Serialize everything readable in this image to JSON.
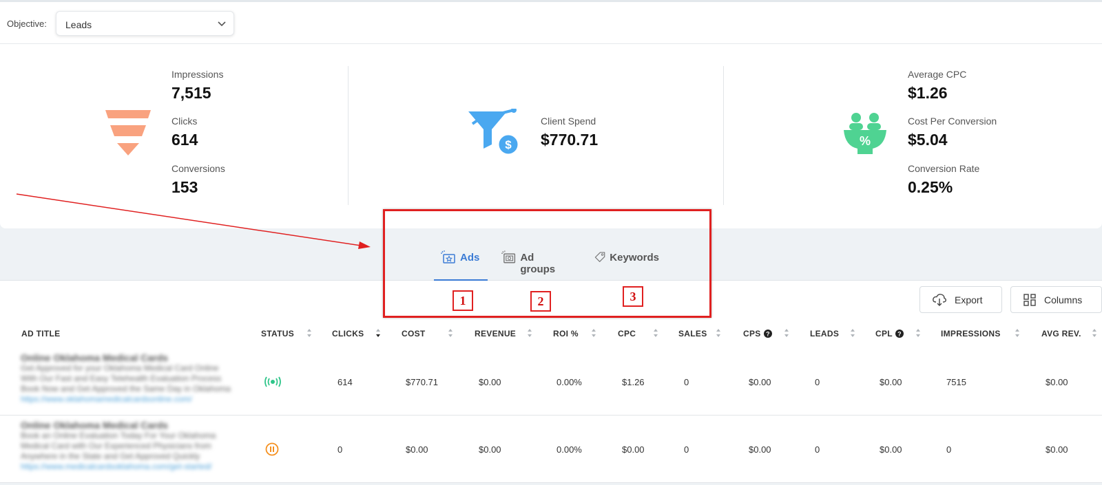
{
  "objective": {
    "label": "Objective:",
    "value": "Leads"
  },
  "summary": {
    "funnel": [
      {
        "label": "Impressions",
        "value": "7,515"
      },
      {
        "label": "Clicks",
        "value": "614"
      },
      {
        "label": "Conversions",
        "value": "153"
      }
    ],
    "spend": {
      "label": "Client Spend",
      "value": "$770.71"
    },
    "rates": [
      {
        "label": "Average CPC",
        "value": "$1.26"
      },
      {
        "label": "Cost Per Conversion",
        "value": "$5.04"
      },
      {
        "label": "Conversion Rate",
        "value": "0.25%"
      }
    ]
  },
  "tabs": [
    {
      "label": "Ads",
      "active": true
    },
    {
      "label": "Ad groups",
      "active": false
    },
    {
      "label": "Keywords",
      "active": false
    }
  ],
  "toolbar": {
    "export_label": "Export",
    "columns_label": "Columns"
  },
  "table": {
    "headers": {
      "ad_title": "AD TITLE",
      "status": "STATUS",
      "clicks": "CLICKS",
      "cost": "COST",
      "revenue": "REVENUE",
      "roi": "ROI %",
      "cpc": "CPC",
      "sales": "SALES",
      "cps": "CPS",
      "leads": "LEADS",
      "cpl": "CPL",
      "impressions": "IMPRESSIONS",
      "avg_rev": "AVG REV."
    },
    "rows": [
      {
        "title": "Online Oklahoma Medical Cards",
        "desc1": "Get Approved for your Oklahoma Medical Card Online",
        "desc2": "With Our Fast and Easy Telehealth Evaluation Process",
        "desc3": "Book Now and Get Approved the Same Day in Oklahoma",
        "url": "https://www.oklahomamedicalcardsonline.com/",
        "status": "active",
        "clicks": "614",
        "cost": "$770.71",
        "revenue": "$0.00",
        "roi": "0.00%",
        "cpc": "$1.26",
        "sales": "0",
        "cps": "$0.00",
        "leads": "0",
        "cpl": "$0.00",
        "impressions": "7515",
        "avg_rev": "$0.00"
      },
      {
        "title": "Online Oklahoma Medical Cards",
        "desc1": "Book an Online Evaluation Today For Your Oklahoma",
        "desc2": "Medical Card with Our Experienced Physicians from",
        "desc3": "Anywhere in the State and Get Approved Quickly",
        "url": "https://www.medicalcardsoklahoma.com/get-started/",
        "status": "paused",
        "clicks": "0",
        "cost": "$0.00",
        "revenue": "$0.00",
        "roi": "0.00%",
        "cpc": "$0.00",
        "sales": "0",
        "cps": "$0.00",
        "leads": "0",
        "cpl": "$0.00",
        "impressions": "0",
        "avg_rev": "$0.00"
      }
    ]
  },
  "annotations": {
    "labels": [
      "1",
      "2",
      "3"
    ],
    "color": "#e02020"
  },
  "colors": {
    "accent": "#3a7bd5",
    "funnel": "#f9a27f",
    "spend_icon": "#4aa8f0",
    "rates_icon": "#4fd392",
    "active_status": "#2fc58a",
    "paused_status": "#f5901f"
  }
}
